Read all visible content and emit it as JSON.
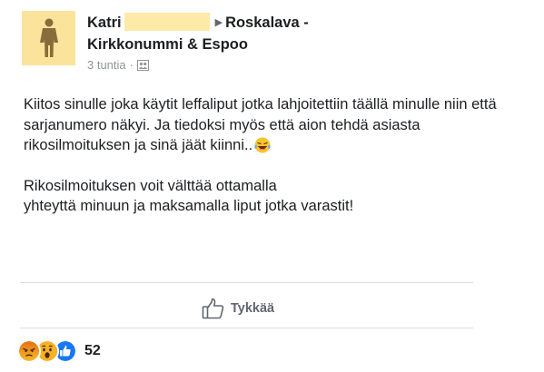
{
  "post": {
    "author_name": "Katri",
    "group_name": "Roskalava -",
    "group_name_line2": "Kirkkonummi & Espoo",
    "time": "3 tuntia",
    "meta_separator": "·",
    "audience_icon": "members-icon",
    "body_p1": "Kiitos sinulle joka käytit leffaliput jotka lahjoitettiin täällä minulle niin että sarjanumero näkyi. Ja tiedoksi myös että aion tehdä asiasta rikosilmoituksen ja sinä jäät kiinni..",
    "body_p1_emoji": "laughing-tears-emoji",
    "body_p2_line1": "Rikosilmoituksen voit välttää ottamalla",
    "body_p2_line2": "yhteyttä minuun ja maksamalla liput jotka varastit!"
  },
  "actions": {
    "like_label": "Tykkää"
  },
  "reactions": {
    "types": [
      "angry",
      "wow",
      "like"
    ],
    "count": "52"
  },
  "colors": {
    "avatar_bg": "#fbe39c",
    "redaction": "#fdeaa8",
    "like_blue": "#1877f2",
    "angry_orange": "#e9710f",
    "wow_yellow": "#f7b125"
  }
}
